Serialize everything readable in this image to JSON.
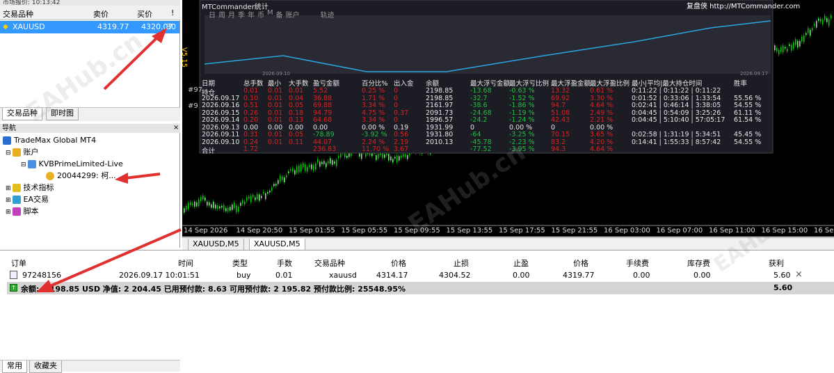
{
  "market_watch": {
    "title": "市场报价: 10:13:42",
    "columns": {
      "symbol": "交易品种",
      "bid": "卖价",
      "ask": "买价",
      "spread": "!"
    },
    "row": {
      "symbol": "XAUUSD",
      "bid": "4319.77",
      "ask": "4320.07",
      "spread": "30"
    },
    "tabs": [
      "交易品种",
      "即时图"
    ]
  },
  "navigator": {
    "title": "导航",
    "root": "TradeMax Global MT4",
    "accounts": "账户",
    "broker": "KVBPrimeLimited-Live",
    "account": "20044299: 柯...",
    "indicators": "技术指标",
    "ea": "EA交易",
    "scripts": "脚本",
    "tabs": [
      "常用",
      "收藏夹"
    ]
  },
  "chart": {
    "panel_title": "MTCommander统计",
    "brand": "复盘侠 http://MTCommander.com",
    "period_buttons": [
      "日",
      "周",
      "月",
      "季",
      "年",
      "币",
      "M",
      "备",
      "账户",
      "轨迹"
    ],
    "v_label": "V5.15",
    "equity_start_date": "2026.09.10",
    "equity_end_date": "2026.09.17",
    "price_markers": [
      "#97",
      "#9"
    ],
    "table": {
      "headers": [
        "日期",
        "总手数",
        "最小",
        "大手数",
        "盈亏金额",
        "百分比%",
        "出入金",
        "余额",
        "最大浮亏金额",
        "最大浮亏比例",
        "最大浮盈金额",
        "最大浮盈比例",
        "最小|平均|最大持仓时间",
        "胜率"
      ],
      "rows": [
        [
          "持仓",
          "0.01",
          "0.01",
          "0.01",
          "5.52",
          "0.25 %",
          "0",
          "2198.85",
          "-13.68",
          "-0.63 %",
          "13.32",
          "0.61 %",
          "0:11:22 | 0:11:22 | 0:11:22",
          ""
        ],
        [
          "2026.09.17",
          "0.10",
          "0.01",
          "0.04",
          "36.88",
          "1.71 %",
          "0",
          "2198.85",
          "-32.7",
          "-1.52 %",
          "69.92",
          "3.30 %",
          "0:01:52 | 0:33:06 | 1:33:54",
          "55.56 %"
        ],
        [
          "2026.09.16",
          "0.51",
          "0.01",
          "0.05",
          "69.88",
          "3.34 %",
          "0",
          "2161.97",
          "-38.6",
          "-1.86 %",
          "94.7",
          "4.64 %",
          "0:02:41 | 0:46:14 | 3:38:05",
          "54.55 %"
        ],
        [
          "2026.09.15",
          "0.26",
          "0.01",
          "0.18",
          "94.79",
          "4.75 %",
          "0.37",
          "2091.73",
          "-24.68",
          "-1.19 %",
          "51.08",
          "2.49 %",
          "0:04:45 | 0:54:09 | 3:25:26",
          "61.11 %"
        ],
        [
          "2026.09.14",
          "0.20",
          "0.01",
          "0.13",
          "64.68",
          "3.34 %",
          "0",
          "1996.57",
          "-24.2",
          "-1.24 %",
          "42.43",
          "2.21 %",
          "0:04:45 | 5:10:40 | 57:05:17",
          "61.54 %"
        ],
        [
          "2026.09.13",
          "0.00",
          "0.00",
          "0.00",
          "0.00",
          "0.00 %",
          "0.19",
          "1931.99",
          "0",
          "0.00 %",
          "0",
          "0.00 %",
          "",
          ""
        ],
        [
          "2026.09.11",
          "0.31",
          "0.01",
          "0.05",
          "-78.89",
          "-3.92 %",
          "0.56",
          "1931.80",
          "-64",
          "-3.25 %",
          "70.15",
          "3.65 %",
          "0:02:58 | 1:31:19 | 5:34:51",
          "45.45 %"
        ],
        [
          "2026.09.10",
          "0.24",
          "0.01",
          "0.11",
          "44.07",
          "2.24 %",
          "2.19",
          "2010.13",
          "-45.78",
          "-2.23 %",
          "83.2",
          "4.20 %",
          "0:14:41 | 1:55:33 | 8:57:42",
          "54.55 %"
        ],
        [
          "合计",
          "1.72",
          "",
          "",
          "236.83",
          "11.70 %",
          "3.67",
          "",
          "-77.52",
          "-3.95 %",
          "94.3",
          "4.64 %",
          "",
          ""
        ]
      ]
    },
    "time_axis": [
      "14 Sep 2026",
      "14 Sep 20:50",
      "15 Sep 01:55",
      "15 Sep 05:55",
      "15 Sep 09:55",
      "15 Sep 13:55",
      "15 Sep 17:55",
      "15 Sep 21:55",
      "16 Sep 03:00",
      "16 Sep 07:00",
      "16 Sep 11:00",
      "16 Sep 15:00",
      "16 Sep 19:00"
    ],
    "tabs": [
      "XAUUSD,M5",
      "XAUUSD,M5"
    ]
  },
  "terminal": {
    "headers": {
      "order": "订单",
      "time": "时间",
      "type": "类型",
      "lots": "手数",
      "symbol": "交易品种",
      "price": "价格",
      "sl": "止损",
      "tp": "止盈",
      "cur_price": "价格",
      "commission": "手续费",
      "swap": "库存费",
      "profit": "获利"
    },
    "row": {
      "order": "97248156",
      "time": "2026.09.17 10:01:51",
      "type": "buy",
      "lots": "0.01",
      "symbol": "xauusd",
      "price": "4314.17",
      "sl": "4304.52",
      "tp": "0.00",
      "cur_price": "4319.77",
      "commission": "0.00",
      "swap": "0.00",
      "profit": "5.60"
    },
    "balance_text": "余额: 2 198.85 USD  净值: 2 204.45  已用预付款: 8.63  可用预付款: 2 195.82  预付款比例: 25548.95%",
    "total_profit": "5.60"
  },
  "watermark": "EAHub.cn",
  "colors": {
    "selection": "#3399ff",
    "equity_line": "#29a8e0",
    "profit_red": "#e02020",
    "loss_green": "#20c040",
    "chart_bg": "#000000",
    "panel_bg": "#202028"
  }
}
